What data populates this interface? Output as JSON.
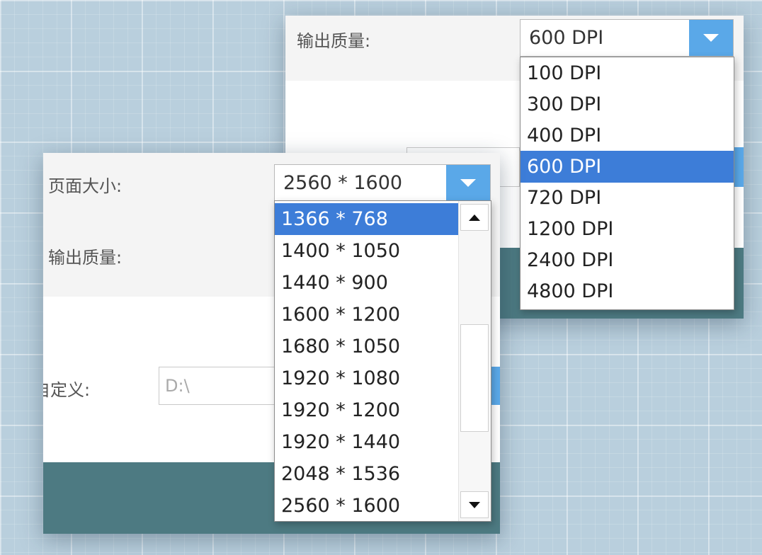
{
  "dpi_window": {
    "quality_label": "输出质量:",
    "quality_value": "600 DPI",
    "options": [
      "100 DPI",
      "300 DPI",
      "400 DPI",
      "600 DPI",
      "720 DPI",
      "1200 DPI",
      "2400 DPI",
      "4800 DPI"
    ],
    "selected_option": "600 DPI"
  },
  "size_window": {
    "page_size_label": "页面大小:",
    "page_size_value": "2560 * 1600",
    "quality_label": "输出质量:",
    "custom_label": "自定义:",
    "path_value": "D:\\",
    "options": [
      "1366 * 768",
      "1400 * 1050",
      "1440 * 900",
      "1600 * 1200",
      "1680 * 1050",
      "1920 * 1080",
      "1920 * 1200",
      "1920 * 1440",
      "2048 * 1536",
      "2560 * 1600"
    ],
    "selected_option": "1366 * 768"
  },
  "colors": {
    "accent": "#5aa8e8",
    "selection": "#3d7dd8",
    "footer": "#4d7a82"
  },
  "icons": {
    "combo_arrow": "chevron-down-icon",
    "scroll_up": "scroll-up-icon",
    "scroll_down": "scroll-down-icon"
  }
}
